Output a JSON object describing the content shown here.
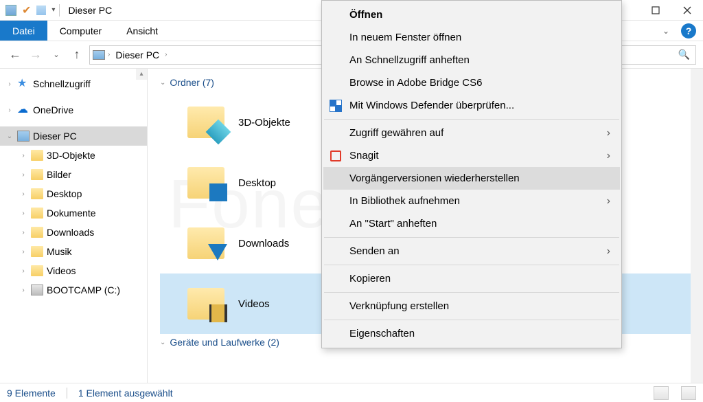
{
  "window": {
    "title": "Dieser PC"
  },
  "ribbon": {
    "file": "Datei",
    "tabs": [
      "Computer",
      "Ansicht"
    ]
  },
  "breadcrumb": {
    "root": "Dieser PC"
  },
  "tree": {
    "quick_access": "Schnellzugriff",
    "onedrive": "OneDrive",
    "this_pc": "Dieser PC",
    "children": [
      "3D-Objekte",
      "Bilder",
      "Desktop",
      "Dokumente",
      "Downloads",
      "Musik",
      "Videos",
      "BOOTCAMP (C:)"
    ]
  },
  "content": {
    "group_folders": "Ordner (7)",
    "group_devices": "Geräte und Laufwerke (2)",
    "folders": [
      "3D-Objekte",
      "Desktop",
      "Downloads",
      "Videos"
    ]
  },
  "context_menu": {
    "open": "Öffnen",
    "open_new_window": "In neuem Fenster öffnen",
    "pin_quick_access": "An Schnellzugriff anheften",
    "browse_bridge": "Browse in Adobe Bridge CS6",
    "defender": "Mit Windows Defender überprüfen...",
    "grant_access": "Zugriff gewähren auf",
    "snagit": "Snagit",
    "previous_versions": "Vorgängerversionen wiederherstellen",
    "include_library": "In Bibliothek aufnehmen",
    "pin_start": "An \"Start\" anheften",
    "send_to": "Senden an",
    "copy": "Kopieren",
    "create_shortcut": "Verknüpfung erstellen",
    "properties": "Eigenschaften"
  },
  "statusbar": {
    "items": "9 Elemente",
    "selected": "1 Element ausgewählt"
  },
  "watermark": "FonePaw"
}
